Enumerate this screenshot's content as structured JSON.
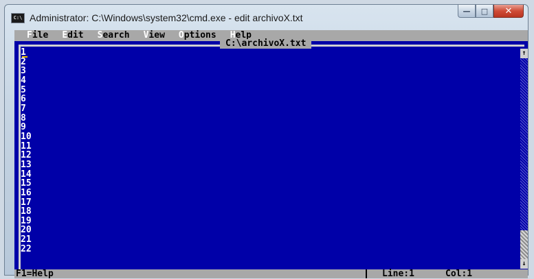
{
  "window": {
    "title": "Administrator: C:\\Windows\\system32\\cmd.exe - edit  archivoX.txt",
    "icon_text": "C:\\",
    "buttons": {
      "minimize": "—",
      "maximize": "□",
      "close": "✕"
    }
  },
  "menubar": {
    "items": [
      {
        "hotkey": "F",
        "rest": "ile"
      },
      {
        "hotkey": "E",
        "rest": "dit"
      },
      {
        "hotkey": "S",
        "rest": "earch"
      },
      {
        "hotkey": "V",
        "rest": "iew"
      },
      {
        "hotkey": "O",
        "rest": "ptions"
      },
      {
        "hotkey": "H",
        "rest": "elp"
      }
    ]
  },
  "document": {
    "title": "C:\\archivoX.txt",
    "line_numbers": [
      "1",
      "2",
      "3",
      "4",
      "5",
      "6",
      "7",
      "8",
      "9",
      "10",
      "11",
      "12",
      "13",
      "14",
      "15",
      "16",
      "17",
      "18",
      "19",
      "20",
      "21",
      "22"
    ]
  },
  "scrollbar": {
    "up": "↑",
    "down": "↓"
  },
  "statusbar": {
    "help": "F1=Help",
    "line": "Line:1",
    "col": "Col:1"
  },
  "colors": {
    "console_bg": "#0000a8",
    "menu_bg": "#a8a8a8",
    "cursor": "#f0c000"
  }
}
